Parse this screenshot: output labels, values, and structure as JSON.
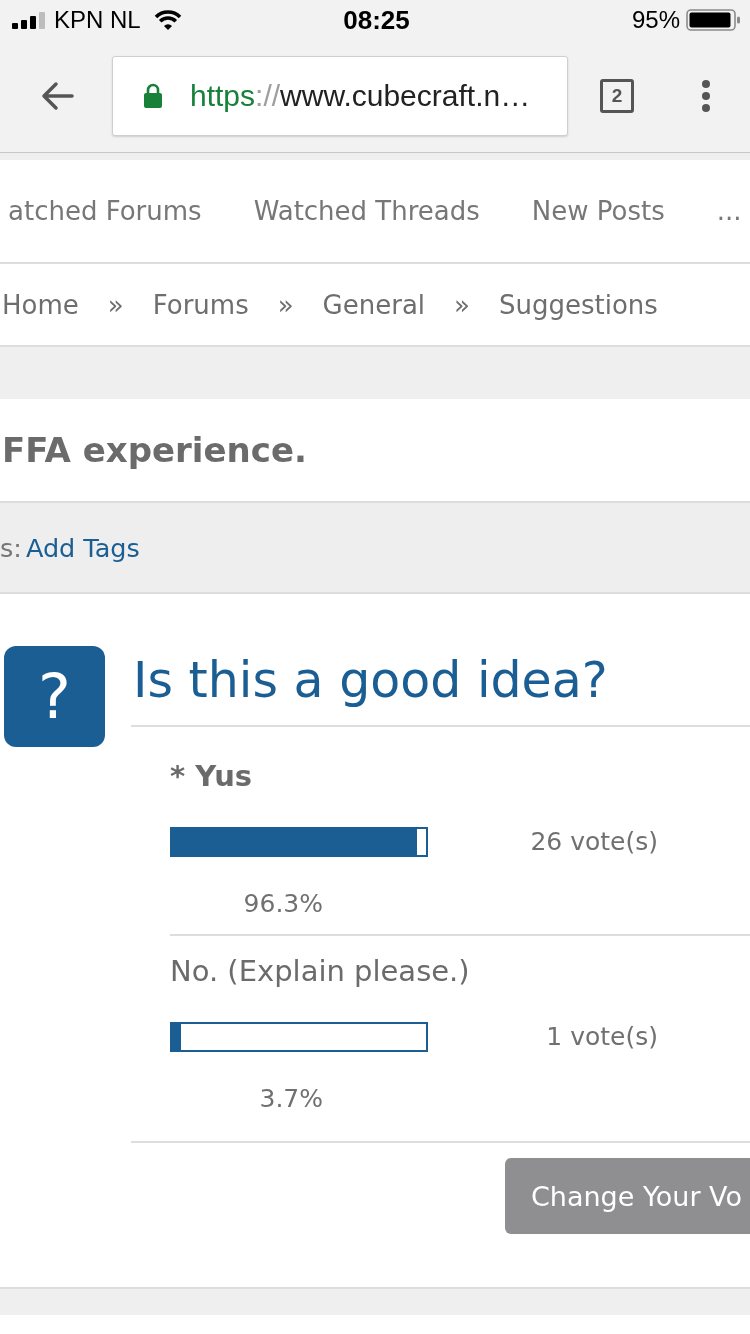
{
  "status_bar": {
    "carrier": "KPN NL",
    "time": "08:25",
    "battery": "95%"
  },
  "browser": {
    "url": {
      "scheme": "https",
      "separator": "://",
      "host": "www.cubecraft.n…"
    },
    "tab_count": "2"
  },
  "nav": [
    {
      "label": "atched Forums"
    },
    {
      "label": "Watched Threads"
    },
    {
      "label": "New Posts"
    },
    {
      "label": "..."
    }
  ],
  "breadcrumb": [
    {
      "label": "Home",
      "separator": "»"
    },
    {
      "label": "Forums",
      "separator": "»"
    },
    {
      "label": "General",
      "separator": "»"
    },
    {
      "label": "Suggestions"
    }
  ],
  "thread": {
    "title": "FFA experience.",
    "tags_label": "s:",
    "tags_link": "Add Tags"
  },
  "poll": {
    "icon": "?",
    "question": "Is this a good idea?",
    "options": [
      {
        "label": "* Yus",
        "voted": true,
        "level": 0.963,
        "percent": "96.3%",
        "votes": "26 vote(s)"
      },
      {
        "label": "No. (Explain please.)",
        "voted": false,
        "level": 0.037,
        "percent": "3.7%",
        "votes": "1 vote(s)"
      }
    ],
    "button": "Change Your Vo"
  }
}
